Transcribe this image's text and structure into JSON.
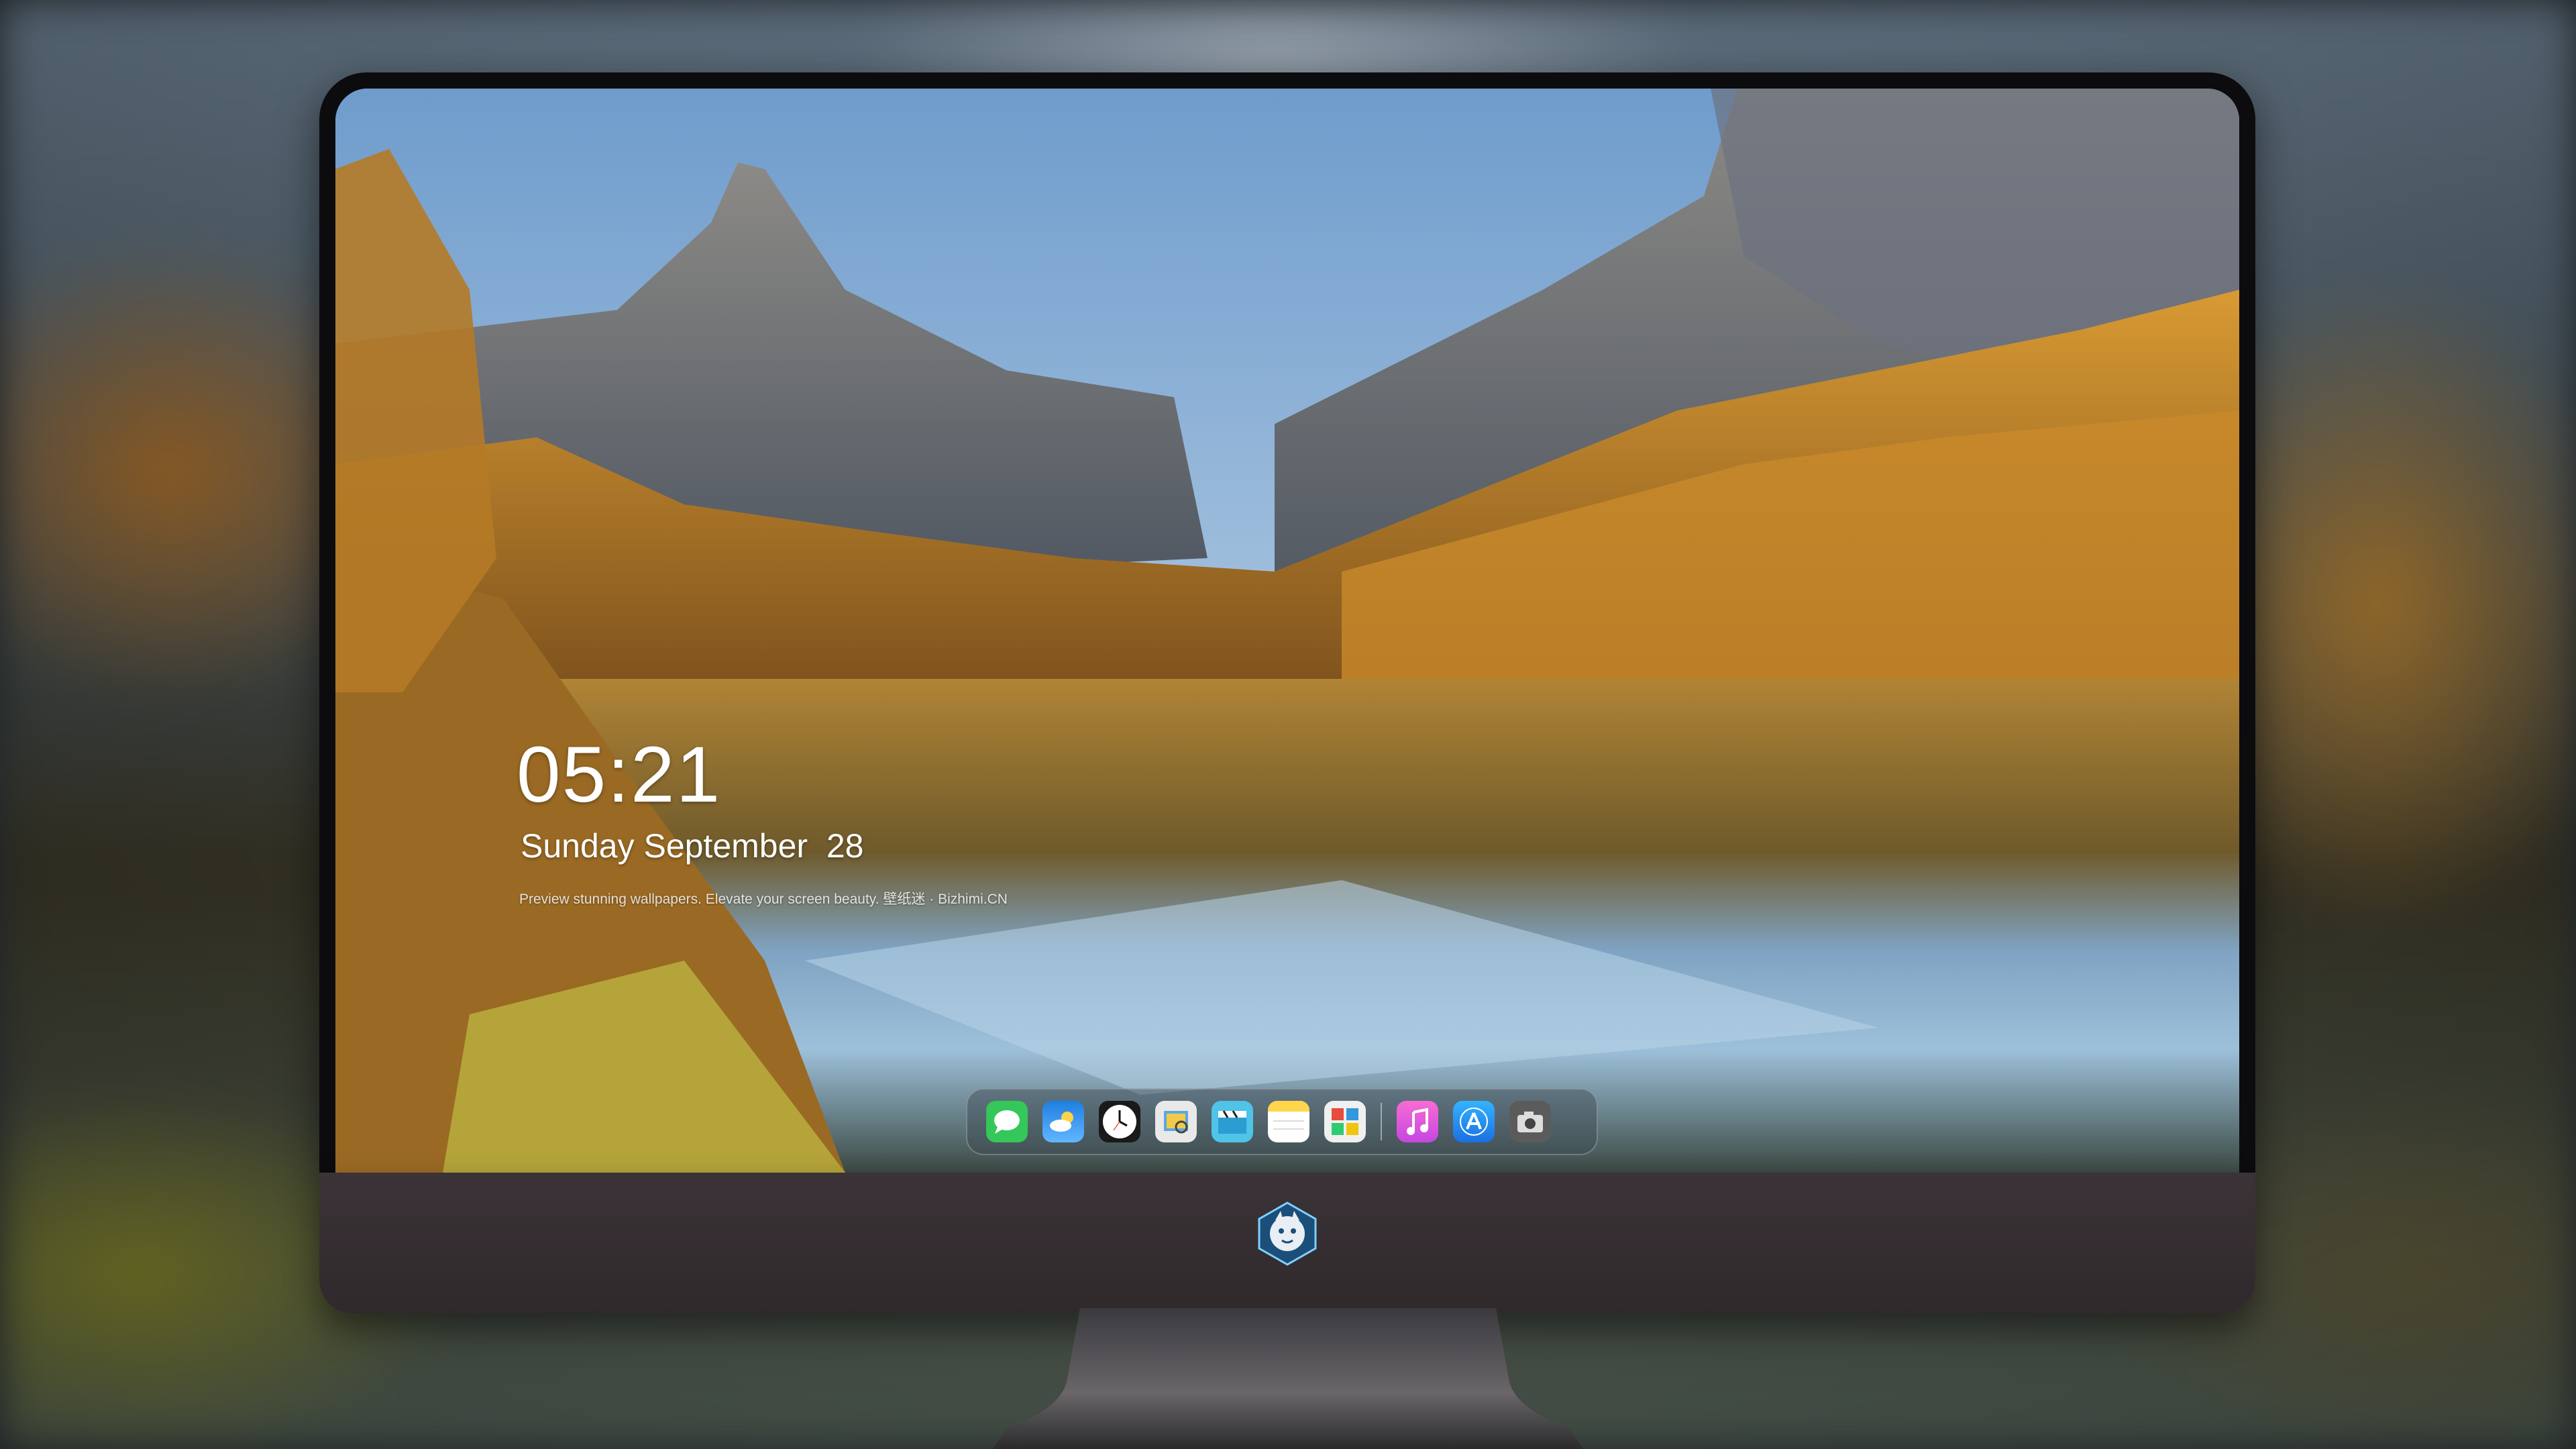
{
  "lock_screen": {
    "time": "05:21",
    "date": "Sunday September  28",
    "tagline": "Preview stunning wallpapers. Elevate your screen beauty. 壁纸迷 · Bizhimi.CN"
  },
  "dock": {
    "items": [
      {
        "icon": "messages-icon",
        "color": "#34c759"
      },
      {
        "icon": "weather-icon",
        "color": "#2f8ff0"
      },
      {
        "icon": "clock-icon",
        "color": "#ffffff"
      },
      {
        "icon": "preview-icon",
        "color": "#e8e8e8"
      },
      {
        "icon": "claquette-icon",
        "color": "#4fc3e8"
      },
      {
        "icon": "notes-icon",
        "color": "#ffd54a"
      },
      {
        "icon": "photo-booth-icon",
        "color": "#f0f0f0"
      },
      {
        "icon": "music-icon",
        "color": "#f55ec8"
      },
      {
        "icon": "app-store-icon",
        "color": "#1e90ff"
      },
      {
        "icon": "screenshot-icon",
        "color": "#555555"
      }
    ]
  },
  "monitor": {
    "bezel_color": "#0c0c0e",
    "chin_color": "#352e31",
    "logo_icon": "dragon-mascot-logo"
  }
}
